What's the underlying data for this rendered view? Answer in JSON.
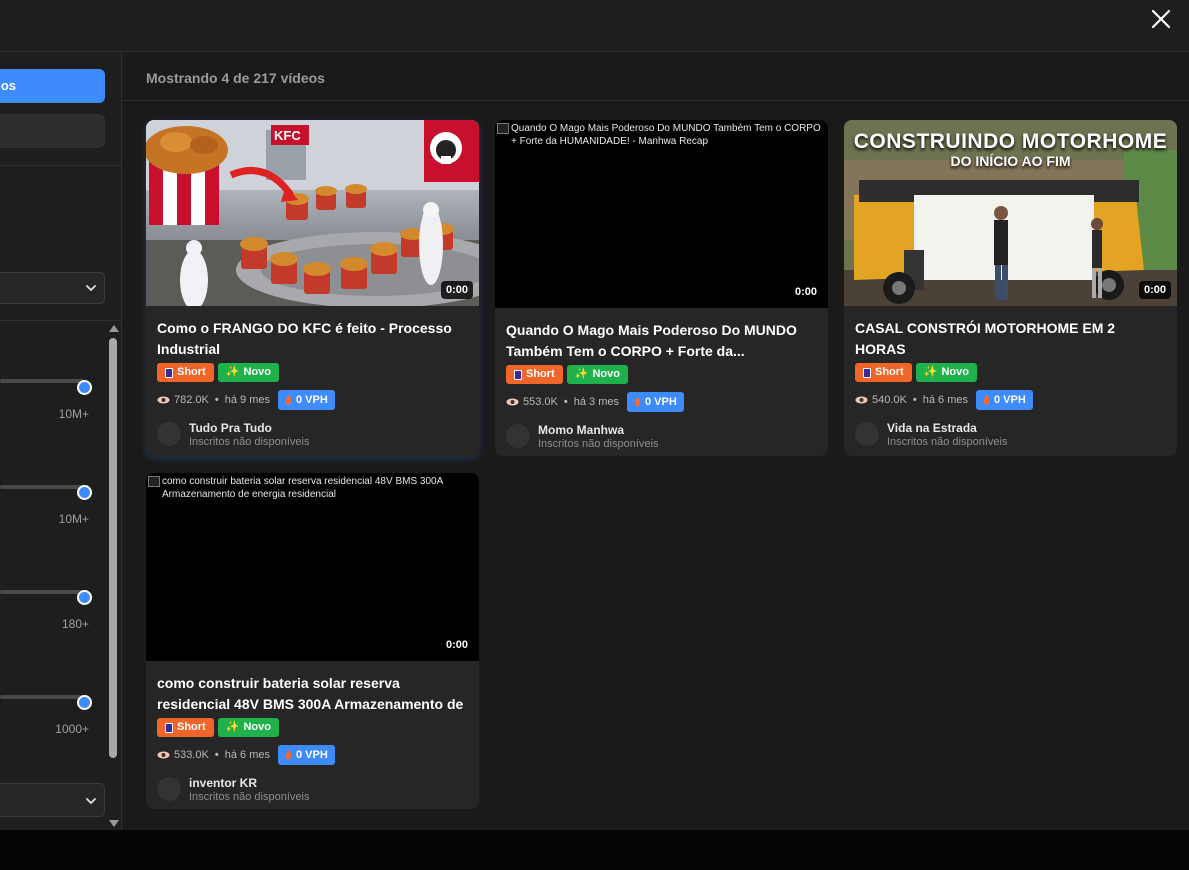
{
  "close_icon": "close-icon",
  "sidebar": {
    "primary_button_label": "os",
    "slider_labels": [
      "10M+",
      "10M+",
      "180+",
      "1000+"
    ]
  },
  "main": {
    "result_count": "Mostrando 4 de 217 vídeos"
  },
  "cards": [
    {
      "title": "Como o FRANGO DO KFC é feito - Processo Industrial",
      "thumb_alt": "",
      "duration": "0:00",
      "badge_short": "Short",
      "badge_novo": "Novo",
      "views": "782.0K",
      "age": "há 9 mes",
      "vph": "0 VPH",
      "channel": "Tudo Pra Tudo",
      "subs": "Inscritos não disponíveis",
      "thumb_logo": "KFC"
    },
    {
      "title": "Quando O Mago Mais Poderoso Do MUNDO Também Tem o CORPO + Forte da...",
      "thumb_alt": "Quando O Mago Mais Poderoso Do MUNDO Também Tem o CORPO + Forte da HUMANIDADE! - Manhwa Recap",
      "duration": "0:00",
      "badge_short": "Short",
      "badge_novo": "Novo",
      "views": "553.0K",
      "age": "há 3 mes",
      "vph": "0 VPH",
      "channel": "Momo Manhwa",
      "subs": "Inscritos não disponíveis"
    },
    {
      "title": "CASAL CONSTRÓI MOTORHOME EM 2 HORAS",
      "thumb_alt": "",
      "duration": "0:00",
      "badge_short": "Short",
      "badge_novo": "Novo",
      "views": "540.0K",
      "age": "há 6 mes",
      "vph": "0 VPH",
      "channel": "Vida na Estrada",
      "subs": "Inscritos não disponíveis",
      "thumb_line1": "CONSTRUINDO MOTORHOME",
      "thumb_line2": "DO INÍCIO AO FIM"
    },
    {
      "title": "como construir bateria solar reserva residencial 48V BMS 300A Armazenamento de energia...",
      "thumb_alt": "como construir bateria solar reserva residencial 48V BMS 300A Armazenamento de energia residencial",
      "duration": "0:00",
      "badge_short": "Short",
      "badge_novo": "Novo",
      "views": "533.0K",
      "age": "há 6 mes",
      "vph": "0 VPH",
      "channel": "inventor KR",
      "subs": "Inscritos não disponíveis"
    }
  ],
  "colors": {
    "accent": "#3d8bfd",
    "short_badge": "#f06529",
    "novo_badge": "#1fb14b",
    "card_bg": "#262626"
  }
}
